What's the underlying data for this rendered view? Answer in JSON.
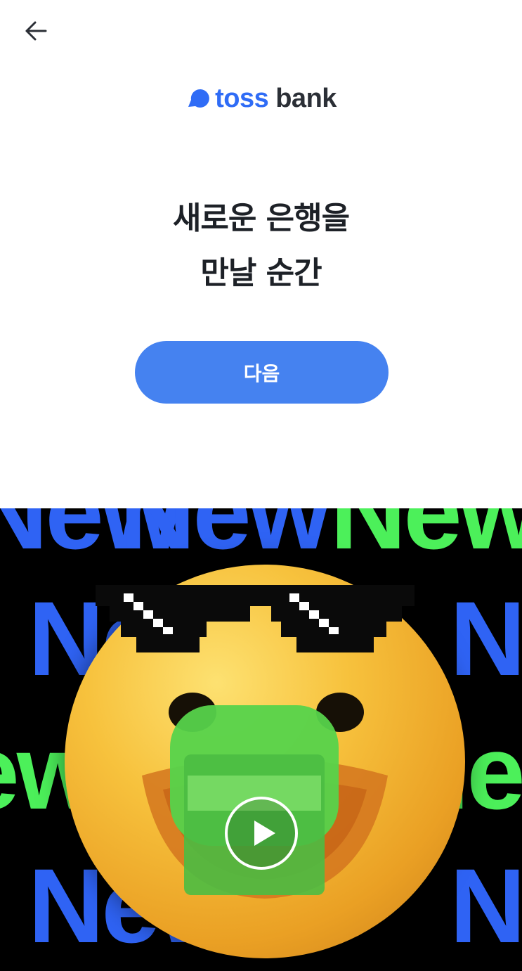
{
  "header": {
    "back_icon": "arrow-left-icon"
  },
  "brand": {
    "toss": "toss",
    "bank": "bank",
    "color_toss": "#2f6cf6",
    "color_bank": "#2b2f36"
  },
  "main": {
    "headline_line1": "새로운 은행을",
    "headline_line2": "만날 순간",
    "next_label": "다음",
    "next_color": "#4582f0"
  },
  "video": {
    "background_word": "New",
    "colors": [
      "#2f63f4",
      "#4cf05a"
    ],
    "play_icon": "play-circle-icon"
  }
}
